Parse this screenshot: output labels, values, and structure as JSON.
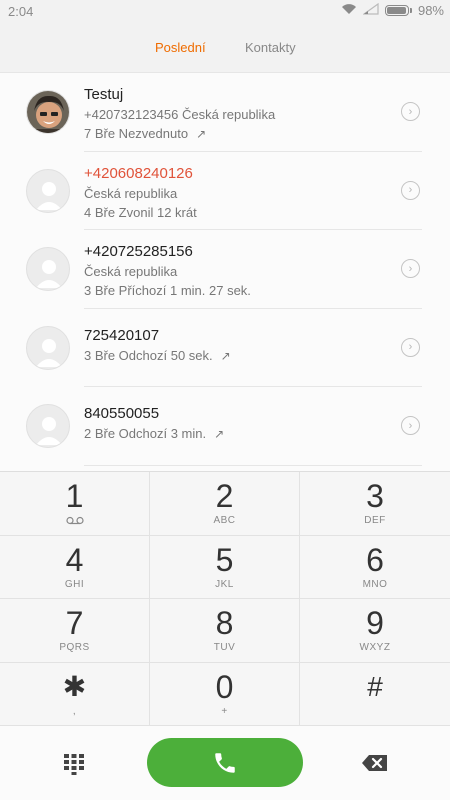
{
  "status": {
    "time": "2:04",
    "battery": "98%"
  },
  "tabs": [
    {
      "label": "Poslední",
      "active": true
    },
    {
      "label": "Kontakty",
      "active": false
    }
  ],
  "calls": [
    {
      "name": "Testuj",
      "line1": "+420732123456  Česká republika",
      "line2": "7 Bře Nezvednuto",
      "missed": false,
      "arrow": "↗",
      "photo": true
    },
    {
      "name": "+420608240126",
      "line1": "Česká republika",
      "line2": "4 Bře Zvonil 12 krát",
      "missed": true,
      "arrow": "",
      "photo": false
    },
    {
      "name": "+420725285156",
      "line1": "Česká republika",
      "line2": "3 Bře Příchozí 1 min. 27 sek.",
      "missed": false,
      "arrow": "",
      "photo": false
    },
    {
      "name": "725420107",
      "line1": "3 Bře Odchozí 50 sek.",
      "line2": "",
      "missed": false,
      "arrow": "↗",
      "photo": false
    },
    {
      "name": "840550055",
      "line1": "2 Bře Odchozí 3 min.",
      "line2": "",
      "missed": false,
      "arrow": "↗",
      "photo": false
    }
  ],
  "keypad": [
    {
      "digit": "1",
      "letters": "⌴⌴",
      "icon": "voicemail-icon"
    },
    {
      "digit": "2",
      "letters": "ABC"
    },
    {
      "digit": "3",
      "letters": "DEF"
    },
    {
      "digit": "4",
      "letters": "GHI"
    },
    {
      "digit": "5",
      "letters": "JKL"
    },
    {
      "digit": "6",
      "letters": "MNO"
    },
    {
      "digit": "7",
      "letters": "PQRS"
    },
    {
      "digit": "8",
      "letters": "TUV"
    },
    {
      "digit": "9",
      "letters": "WXYZ"
    },
    {
      "digit": "✱",
      "letters": ","
    },
    {
      "digit": "0",
      "letters": "+"
    },
    {
      "digit": "#",
      "letters": ""
    }
  ],
  "colors": {
    "accent": "#ef6c00",
    "call_button": "#4caf3a",
    "missed": "#e0533a"
  },
  "icons": {
    "dialpad": "dialpad-icon",
    "call": "phone-icon",
    "backspace": "backspace-icon",
    "info": "chevron-right-icon"
  }
}
